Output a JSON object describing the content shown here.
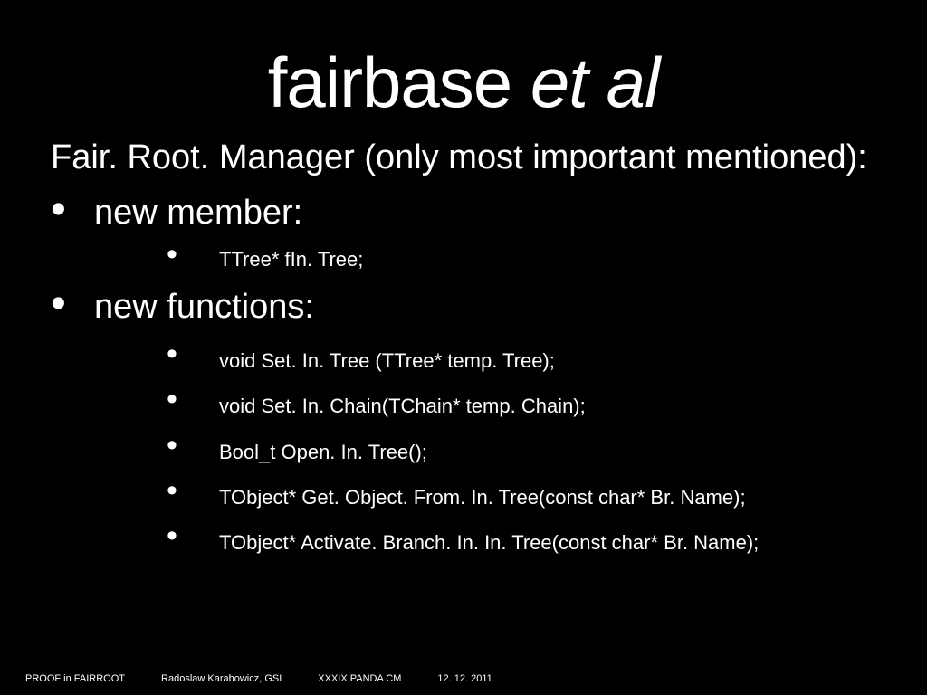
{
  "title": {
    "normal": "fairbase ",
    "italic": "et al"
  },
  "subtitle": "Fair. Root. Manager (only most important mentioned):",
  "bullets": [
    {
      "label": "new member:",
      "sub": [
        "TTree* fIn. Tree;"
      ]
    },
    {
      "label": "new functions:",
      "sub": [
        "void Set. In. Tree (TTree*  temp. Tree);",
        "void Set. In. Chain(TChain* temp. Chain);",
        "Bool_t Open. In. Tree();",
        " TObject* Get. Object. From. In. Tree(const char* Br. Name);",
        "TObject*  Activate. Branch. In. In. Tree(const char* Br. Name);"
      ]
    }
  ],
  "footer": {
    "left": "PROOF in FAIRROOT",
    "author": "Radoslaw Karabowicz, GSI",
    "event": "XXXIX PANDA CM",
    "date": "12. 12. 2011"
  }
}
